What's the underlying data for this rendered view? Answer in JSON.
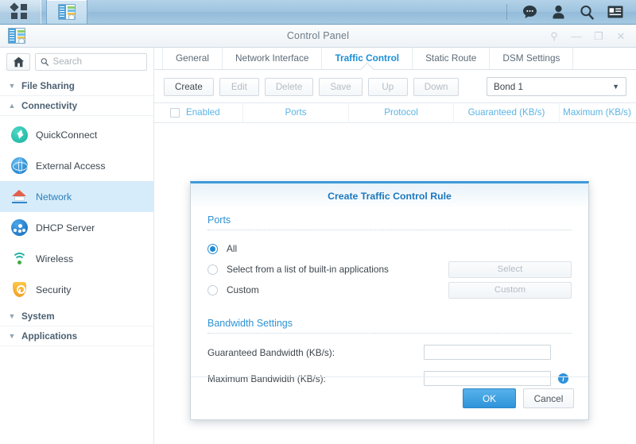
{
  "taskbar": {
    "main_menu_icon": "grid-menu-icon",
    "task_icon": "control-panel-task-icon",
    "tray": [
      {
        "icon": "notifications-chat-icon",
        "name": "notifications"
      },
      {
        "icon": "user-account-icon",
        "name": "user-account"
      },
      {
        "icon": "search-icon",
        "name": "search"
      },
      {
        "icon": "widgets-card-icon",
        "name": "widgets"
      }
    ]
  },
  "window": {
    "title": "Control Panel",
    "icon": "control-panel-icon",
    "controls": [
      {
        "name": "pin-window-button",
        "glyph": "⚲"
      },
      {
        "name": "minimize-window-button",
        "glyph": "—"
      },
      {
        "name": "maximize-window-button",
        "glyph": "❐"
      },
      {
        "name": "close-window-button",
        "glyph": "✕"
      }
    ]
  },
  "sidebar": {
    "home_icon": "home-icon",
    "search": {
      "placeholder": "Search",
      "value": "",
      "icon": "search-icon"
    },
    "groups": [
      {
        "label": "File Sharing",
        "expanded": false,
        "chevron": "▼"
      },
      {
        "label": "Connectivity",
        "expanded": true,
        "chevron": "▲"
      }
    ],
    "items": [
      {
        "label": "QuickConnect",
        "icon": "quickconnect-icon",
        "active": false
      },
      {
        "label": "External Access",
        "icon": "globe-icon",
        "active": false
      },
      {
        "label": "Network",
        "icon": "network-house-icon",
        "active": true
      },
      {
        "label": "DHCP Server",
        "icon": "dhcp-server-icon",
        "active": false
      },
      {
        "label": "Wireless",
        "icon": "wireless-icon",
        "active": false
      },
      {
        "label": "Security",
        "icon": "shield-icon",
        "active": false
      }
    ],
    "groups_bottom": [
      {
        "label": "System",
        "expanded": false,
        "chevron": "▼"
      },
      {
        "label": "Applications",
        "expanded": false,
        "chevron": "▼"
      }
    ]
  },
  "main": {
    "tabs": [
      {
        "label": "General",
        "active": false
      },
      {
        "label": "Network Interface",
        "active": false
      },
      {
        "label": "Traffic Control",
        "active": true
      },
      {
        "label": "Static Route",
        "active": false
      },
      {
        "label": "DSM Settings",
        "active": false
      }
    ],
    "toolbar": {
      "buttons": [
        {
          "label": "Create",
          "disabled": false
        },
        {
          "label": "Edit",
          "disabled": true
        },
        {
          "label": "Delete",
          "disabled": true
        },
        {
          "label": "Save",
          "disabled": true
        },
        {
          "label": "Up",
          "disabled": true
        },
        {
          "label": "Down",
          "disabled": true
        }
      ],
      "interface_select": {
        "value": "Bond 1",
        "arrow": "▼"
      }
    },
    "table": {
      "columns": [
        "Enabled",
        "Ports",
        "Protocol",
        "Guaranteed (KB/s)",
        "Maximum (KB/s)"
      ],
      "rows": []
    }
  },
  "dialog": {
    "title": "Create Traffic Control Rule",
    "sections": {
      "ports": {
        "title": "Ports",
        "options": [
          {
            "label": "All",
            "selected": true,
            "action": null
          },
          {
            "label": "Select from a list of built-in applications",
            "selected": false,
            "action": "Select"
          },
          {
            "label": "Custom",
            "selected": false,
            "action": "Custom"
          }
        ]
      },
      "bandwidth": {
        "title": "Bandwidth Settings",
        "fields": [
          {
            "label": "Guaranteed Bandwidth (KB/s):",
            "value": "",
            "info": false
          },
          {
            "label": "Maximum Bandwidth (KB/s):",
            "value": "",
            "info": true
          }
        ],
        "info_icon": "info-icon"
      }
    },
    "footer": {
      "ok": "OK",
      "cancel": "Cancel"
    }
  },
  "colors": {
    "accent": "#1b8fd6",
    "header_blue": "#5bb4e5",
    "taskbar": "#9fc4df",
    "active_item_bg": "#d7ecfa"
  }
}
